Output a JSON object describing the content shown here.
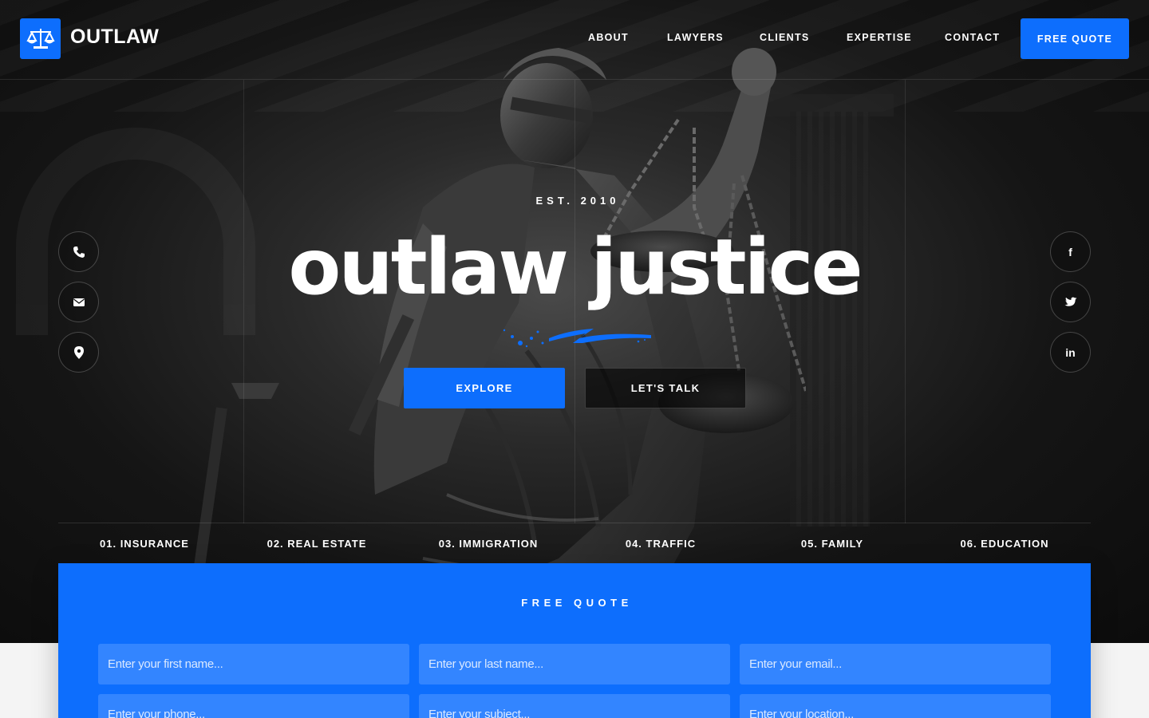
{
  "brand": {
    "name": "OUTLAW",
    "icon": "scales-icon"
  },
  "nav": {
    "items": [
      "ABOUT",
      "LAWYERS",
      "CLIENTS",
      "EXPERTISE",
      "CONTACT"
    ],
    "cta": "FREE QUOTE"
  },
  "hero": {
    "eyebrow": "EST. 2010",
    "title": "outlaw justice",
    "primary_button": "EXPLORE",
    "secondary_button": "LET'S TALK"
  },
  "contact_icons": [
    "phone-icon",
    "mail-icon",
    "location-pin-icon"
  ],
  "social": {
    "facebook": "f",
    "twitter": "twitter-bird-icon",
    "linkedin": "in"
  },
  "practice_areas": [
    "01. INSURANCE",
    "02. REAL ESTATE",
    "03. IMMIGRATION",
    "04. TRAFFIC",
    "05. FAMILY",
    "06. EDUCATION"
  ],
  "quote_form": {
    "title": "FREE QUOTE",
    "fields": {
      "first_name": "Enter your first name...",
      "last_name": "Enter your last name...",
      "email": "Enter your email...",
      "phone": "Enter your phone...",
      "subject": "Enter your subject...",
      "location": "Enter your location..."
    }
  },
  "colors": {
    "accent": "#0d6efd",
    "field": "#3385ff",
    "hero_bg": "#111111"
  }
}
